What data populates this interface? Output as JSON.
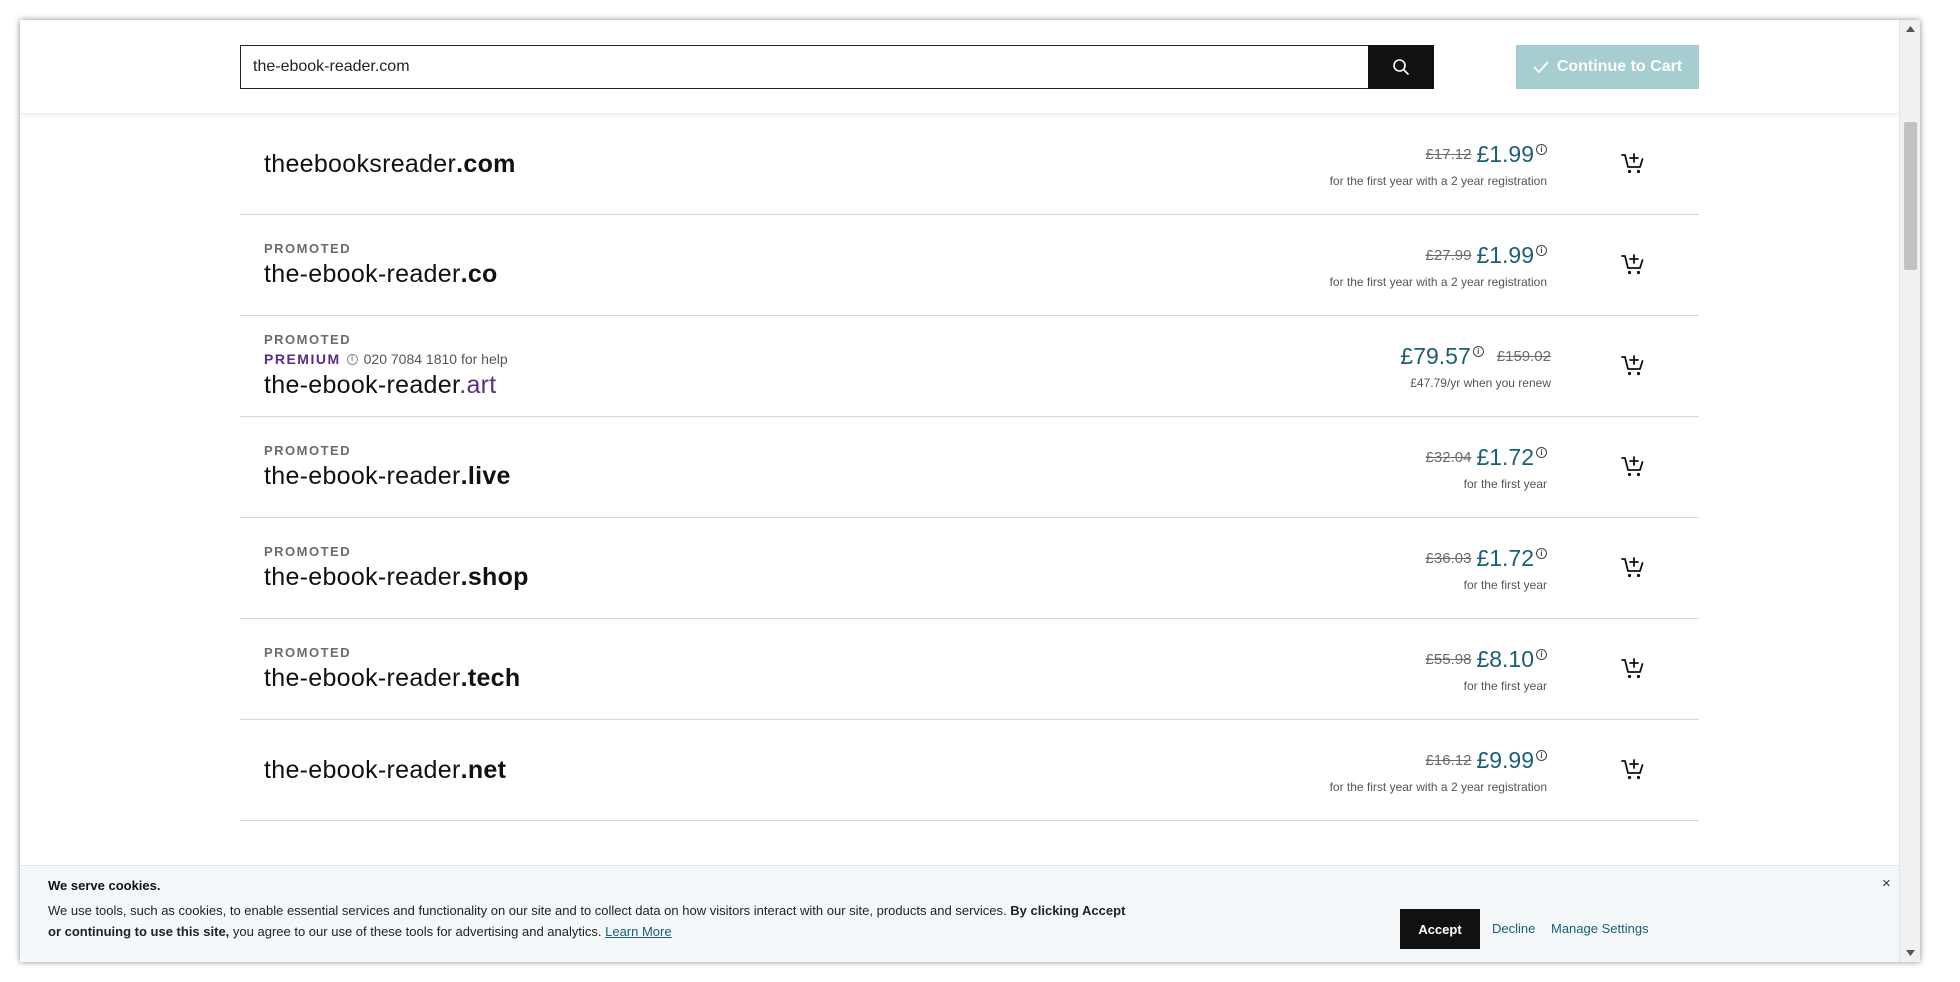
{
  "search": {
    "value": "the-ebook-reader.com",
    "continue_label": "Continue to Cart"
  },
  "results": [
    {
      "base": "theebooksreader",
      "tld": ".com",
      "promoted": "",
      "premium": false,
      "old_price": "£17.12",
      "price": "£1.99",
      "note": "for the first year with a 2 year registration"
    },
    {
      "base": "the-ebook-reader",
      "tld": ".co",
      "promoted": "PROMOTED",
      "premium": false,
      "old_price": "£27.99",
      "price": "£1.99",
      "note": "for the first year with a 2 year registration"
    },
    {
      "base": "the-ebook-reader",
      "tld": ".art",
      "promoted": "PROMOTED",
      "premium": true,
      "premium_label": "PREMIUM",
      "help_text": "020 7084 1810 for help",
      "old_price": "£159.02",
      "price": "£79.57",
      "note": "£47.79/yr when you renew"
    },
    {
      "base": "the-ebook-reader",
      "tld": ".live",
      "promoted": "PROMOTED",
      "premium": false,
      "old_price": "£32.04",
      "price": "£1.72",
      "note": "for the first year"
    },
    {
      "base": "the-ebook-reader",
      "tld": ".shop",
      "promoted": "PROMOTED",
      "premium": false,
      "old_price": "£36.03",
      "price": "£1.72",
      "note": "for the first year"
    },
    {
      "base": "the-ebook-reader",
      "tld": ".tech",
      "promoted": "PROMOTED",
      "premium": false,
      "old_price": "£55.98",
      "price": "£8.10",
      "note": "for the first year"
    },
    {
      "base": "the-ebook-reader",
      "tld": ".net",
      "promoted": "",
      "premium": false,
      "old_price": "£16.12",
      "price": "£9.99",
      "note": "for the first year with a 2 year registration"
    }
  ],
  "cookie": {
    "title": "We serve cookies.",
    "text_part1": "We use tools, such as cookies, to enable essential services and functionality on our site and to collect data on how visitors interact with our site, products and services.",
    "text_bold": "By clicking Accept or continuing to use this site,",
    "text_part2": "you agree to our use of these tools for advertising and analytics.",
    "learn_more": "Learn More",
    "accept": "Accept",
    "decline": "Decline",
    "manage": "Manage Settings",
    "close": "×"
  },
  "colors": {
    "accent": "#1b5e75",
    "premium": "#5a2d82",
    "continue_button": "#a6cdd0"
  },
  "icons": {
    "search": "search-icon",
    "check": "check-icon",
    "cart": "add-to-cart-icon",
    "info": "info-icon",
    "close": "close-icon"
  }
}
